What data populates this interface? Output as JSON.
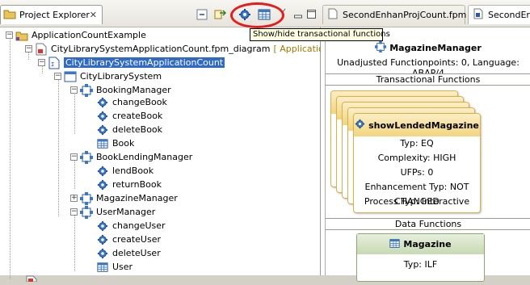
{
  "left_panel": {
    "tab_title": "Project Explorer",
    "tooltip": "Show/hide transactional functions",
    "tree": {
      "root": "ApplicationCountExample",
      "diagram_file": "CityLibrarySystemApplicationCount.fpm_diagram",
      "diagram_suffix": "[ Application Cour",
      "app_count": "CityLibrarySystemApplicationCount",
      "system": "CityLibrarySystem",
      "booking_manager": "BookingManager",
      "change_book": "changeBook",
      "create_book": "createBook",
      "delete_book": "deleteBook",
      "book": "Book",
      "book_lending_manager": "BookLendingManager",
      "lend_book": "lendBook",
      "return_book": "returnBook",
      "magazine_manager": "MagazineManager",
      "user_manager": "UserManager",
      "change_user": "changeUser",
      "create_user": "createUser",
      "delete_user": "deleteUser",
      "user": "User"
    }
  },
  "right_panel": {
    "tabs": [
      "SecondEnhanProjCount.fpm",
      "SecondEr"
    ],
    "diagram": {
      "title": "MagazineManager",
      "info": "Unadjusted Functionpoints: 0, Language: ABAP/4",
      "transactional_header": "Transactional Functions",
      "front_card": {
        "title": "showLendedMagazine",
        "typ": "Typ: EQ",
        "complexity": "Complexity: HIGH",
        "ufps": "UFPs: 0",
        "enhancement": "Enhancement Typ: NOT CHANGED",
        "process": "Process Typ: Interactive"
      },
      "data_header": "Data Functions",
      "data_card": {
        "title": "Magazine",
        "typ": "Typ: ILF"
      }
    }
  },
  "colors": {
    "selection": "#316ac5",
    "highlight_ellipse": "#e61c1c",
    "tooltip_bg": "#ffffe1",
    "card_header": "#f2d57d",
    "data_card_header": "#c7d9b4"
  }
}
